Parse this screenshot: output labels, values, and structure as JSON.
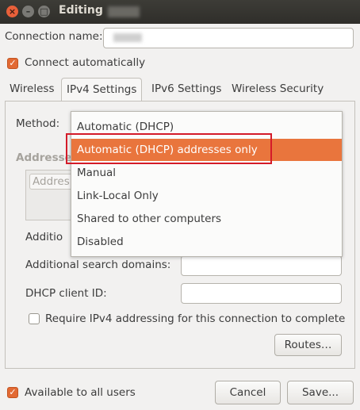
{
  "window": {
    "title": "Editing",
    "controls": {
      "close": "×",
      "minimize": "–",
      "maximize": "□"
    }
  },
  "connection": {
    "name_label": "Connection name:",
    "connect_auto_label": "Connect automatically",
    "connect_auto_checked": true
  },
  "tabs": [
    {
      "label": "Wireless",
      "active": false
    },
    {
      "label": "IPv4 Settings",
      "active": true
    },
    {
      "label": "IPv6 Settings",
      "active": false
    },
    {
      "label": "Wireless Security",
      "active": false
    }
  ],
  "ipv4": {
    "method_label": "Method:",
    "addresses_label": "Addresse",
    "addresses_column": "Addres",
    "additional_dns_label": "Additio",
    "additional_search_label": "Additional search domains:",
    "dhcp_client_label": "DHCP client ID:",
    "require_label": "Require IPv4 addressing for this connection to complete",
    "require_checked": false,
    "routes_button": "Routes…"
  },
  "method_menu": {
    "selected_index": 1,
    "options": [
      "Automatic (DHCP)",
      "Automatic (DHCP) addresses only",
      "Manual",
      "Link-Local Only",
      "Shared to other computers",
      "Disabled"
    ]
  },
  "footer": {
    "all_users_label": "Available to all users",
    "all_users_checked": true,
    "cancel": "Cancel",
    "save": "Save..."
  },
  "colors": {
    "accent": "#e9753d",
    "highlight_box": "#d41b29",
    "titlebar": "#3d3c37"
  }
}
